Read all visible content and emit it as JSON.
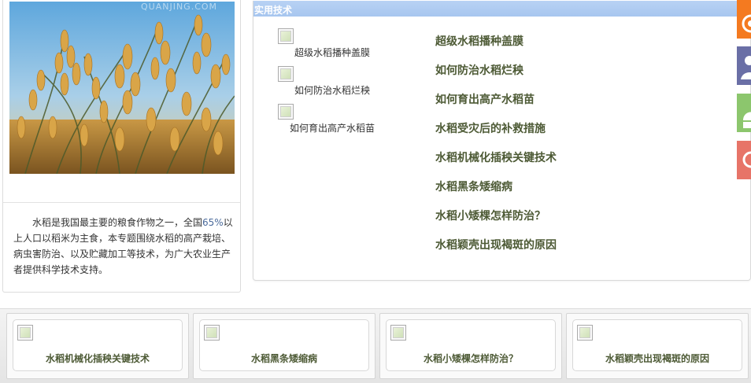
{
  "hero": {
    "watermark": "QUANJING.COM"
  },
  "intro": {
    "before": "水稻是我国最主要的粮食作物之一，全国",
    "percent": "65%",
    "after": "以上人口以稻米为主食，本专题围绕水稻的高产栽培、病虫害防治、以及贮藏加工等技术，为广大农业生产者提供科学技术支持。"
  },
  "tech": {
    "title": "实用技术",
    "thumbs": [
      {
        "caption": "超级水稻播种盖膜"
      },
      {
        "caption": "如何防治水稻烂秧"
      },
      {
        "caption": "如何育出高产水稻苗"
      }
    ],
    "links": [
      "超级水稻播种盖膜",
      "如何防治水稻烂秧",
      "如何育出高产水稻苗",
      "水稻受灾后的补救措施",
      "水稻机械化插秧关键技术",
      "水稻黑条矮缩病",
      "水稻小矮棵怎样防治？",
      "水稻颖壳出现褐斑的原因"
    ]
  },
  "social": [
    {
      "icon": "rss-icon",
      "color": "#f47a20"
    },
    {
      "icon": "person-icon",
      "color": "#6a6fa6"
    },
    {
      "icon": "android-icon",
      "color": "#8cc66d"
    },
    {
      "icon": "weibo-icon",
      "color": "#e77468"
    }
  ],
  "carousel": {
    "prev_arrow": "‹",
    "next_arrow": "›",
    "cards": [
      {
        "title": "水稻机械化插秧关键技术"
      },
      {
        "title": "水稻黑条矮缩病"
      },
      {
        "title": "水稻小矮棵怎样防治？"
      },
      {
        "title": "水稻颖壳出现褐斑的原因"
      }
    ]
  }
}
